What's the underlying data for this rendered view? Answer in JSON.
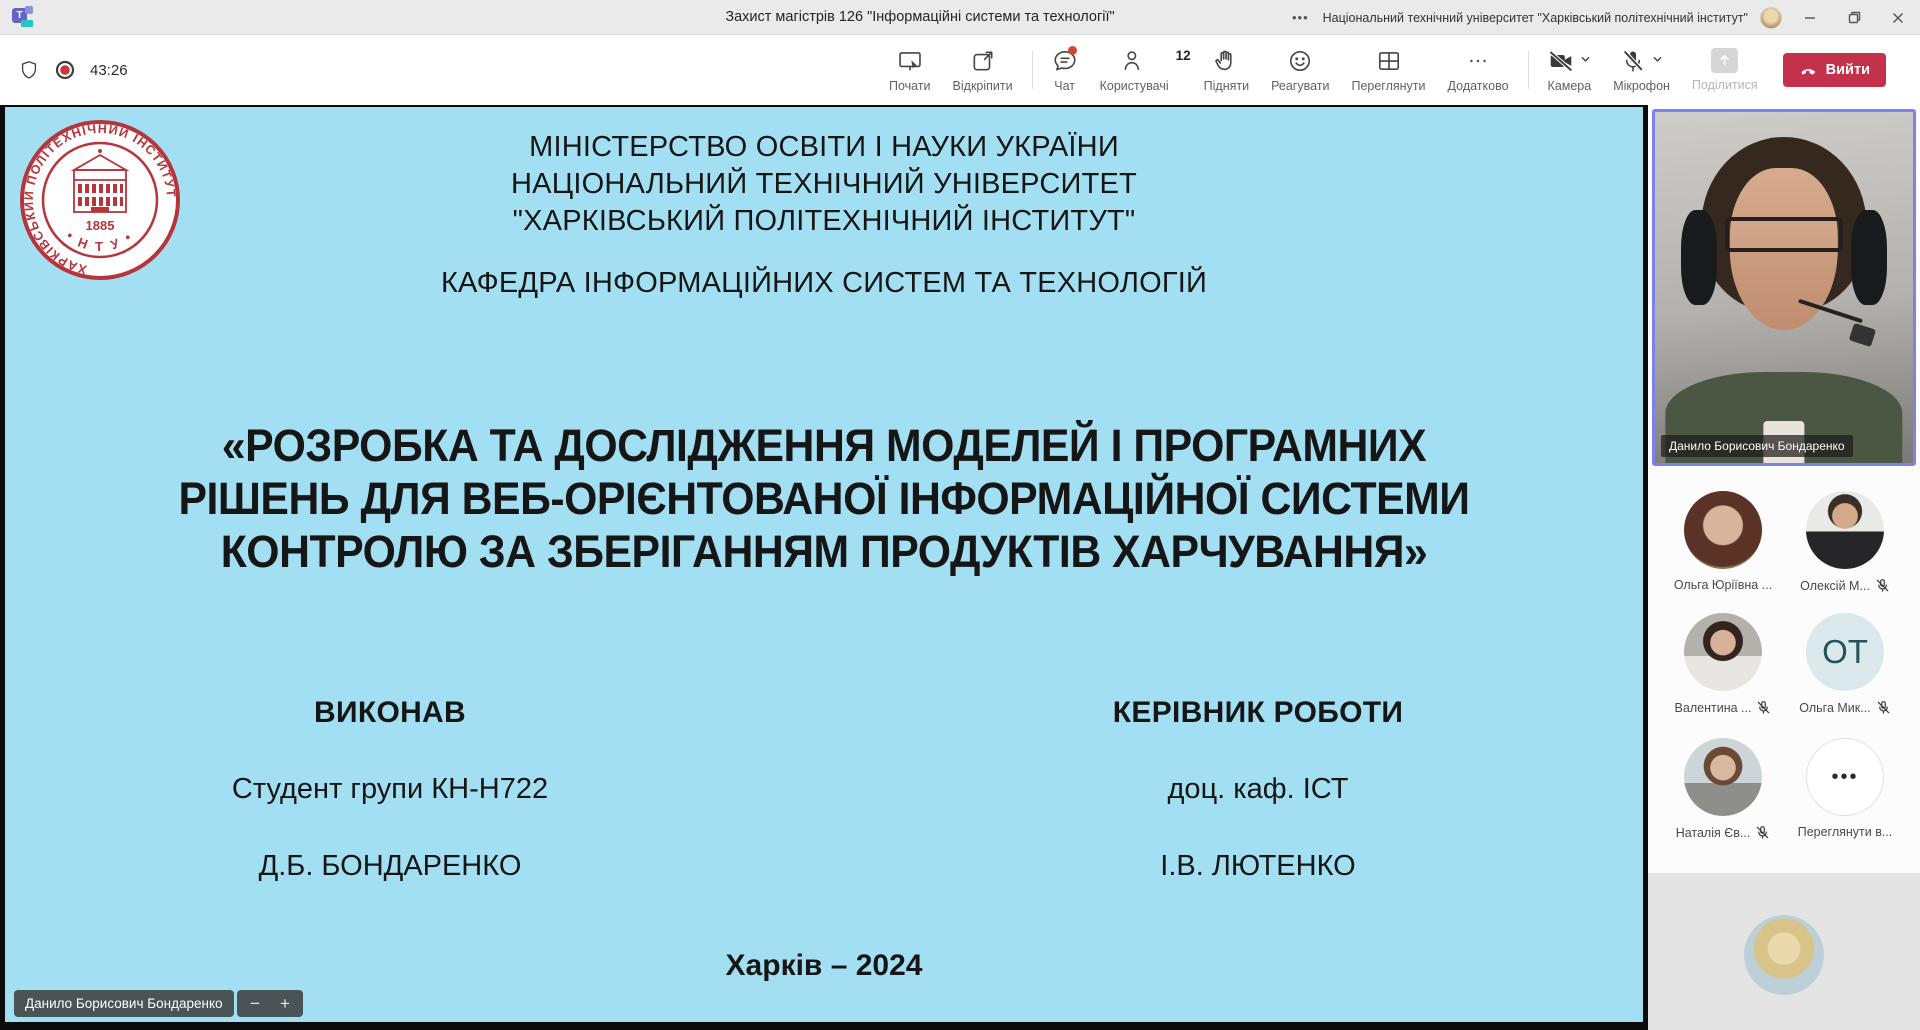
{
  "window": {
    "title": "Захист магістрів 126 \"Інформаційні системи та технології\"",
    "org": "Національний технічний університет \"Харківський політехнічний інститут\"",
    "overflow_glyph": "•••"
  },
  "toolbar": {
    "timer": "43:26",
    "start": "Почати",
    "unpin": "Відкріпити",
    "chat": "Чат",
    "people": "Користувачі",
    "people_count": "12",
    "raise": "Підняти",
    "react": "Реагувати",
    "view": "Переглянути",
    "more": "Додатково",
    "camera": "Камера",
    "mic": "Мікрофон",
    "share": "Поділитися",
    "leave": "Вийти"
  },
  "slide": {
    "ministry_lines": [
      "МІНІСТЕРСТВО ОСВІТИ І НАУКИ УКРАЇНИ",
      "НАЦІОНАЛЬНИЙ ТЕХНІЧНИЙ УНІВЕРСИТЕТ",
      "\"ХАРКІВСЬКИЙ ПОЛІТЕХНІЧНИЙ ІНСТИТУТ\""
    ],
    "department": "КАФЕДРА  ІНФОРМАЦІЙНИХ СИСТЕМ ТА ТЕХНОЛОГІЙ",
    "title_lines": [
      "«РОЗРОБКА ТА ДОСЛІДЖЕННЯ  МОДЕЛЕЙ І ПРОГРАМНИХ",
      "РІШЕНЬ ДЛЯ ВЕБ-ОРІЄНТОВАНОЇ ІНФОРМАЦІЙНОЇ СИСТЕМИ",
      "КОНТРОЛЮ ЗА ЗБЕРІГАННЯМ ПРОДУКТІВ ХАРЧУВАННЯ»"
    ],
    "executor": {
      "heading": "ВИКОНАВ",
      "line1": "Студент групи КН-Н722",
      "line2": "Д.Б. БОНДАРЕНКО"
    },
    "supervisor": {
      "heading": "КЕРІВНИК РОБОТИ",
      "line1": "доц. каф. ІСТ",
      "line2": "І.В. ЛЮТЕНКО"
    },
    "footer": "Харків – 2024",
    "logo": {
      "ring_text": "ХАРКІВСЬКИЙ ПОЛІТЕХНІЧНИЙ ІНСТИТУТ",
      "ntu": "• Н Т У •",
      "year": "1885"
    },
    "presenter_pill": "Данило Борисович Бондаренко",
    "zoom_out": "−",
    "zoom_in": "+"
  },
  "sidebar": {
    "main_name": "Данило Борисович Бондаренко",
    "participants": [
      {
        "label": "Ольга Юріївна ..."
      },
      {
        "label": "Олексій М..."
      },
      {
        "label": "Валентина ..."
      },
      {
        "label": "Ольга Мик...",
        "initials": "ОТ"
      },
      {
        "label": "Наталія Єв..."
      },
      {
        "label": "Переглянути в...",
        "glyph": "•••"
      }
    ]
  },
  "colors": {
    "speaking_border": "#7b83eb",
    "leave_red": "#c4314b",
    "record_red": "#d13438",
    "chat_badge_red": "#cc4a31",
    "slide_bg": "#a3dff2",
    "logo_red": "#b5353b",
    "initials_bg": "#dce9ec",
    "initials_fg": "#22545c"
  }
}
